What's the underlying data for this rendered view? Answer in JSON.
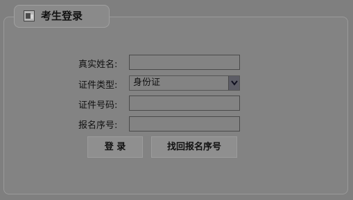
{
  "header": {
    "title": "考生登录",
    "icon": "login-icon"
  },
  "form": {
    "name_label": "真实姓名:",
    "name_value": "",
    "id_type_label": "证件类型:",
    "id_type_value": "身份证",
    "id_number_label": "证件号码:",
    "id_number_value": "",
    "reg_number_label": "报名序号:",
    "reg_number_value": ""
  },
  "buttons": {
    "login_label": "登 录",
    "recover_label": "找回报名序号"
  },
  "colors": {
    "overlay_gray": "#7f7f7f",
    "text": "#111111"
  }
}
